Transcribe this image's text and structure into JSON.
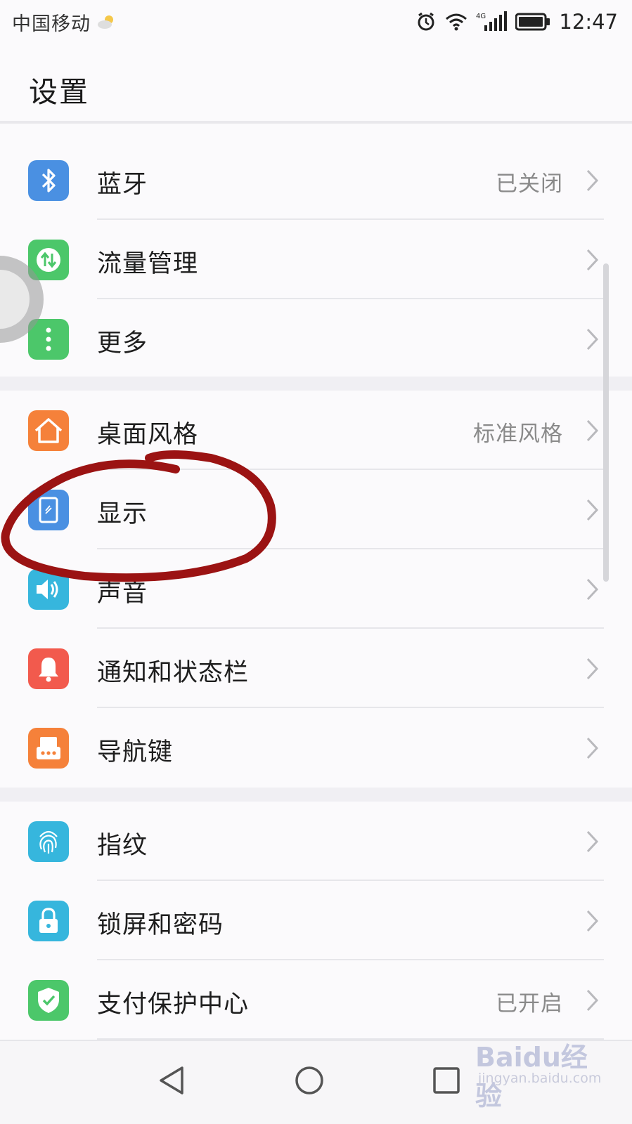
{
  "status_bar": {
    "carrier": "中国移动",
    "time": "12:47",
    "network": "4G"
  },
  "header": {
    "title": "设置"
  },
  "groups": [
    {
      "rows": [
        {
          "label": "蓝牙",
          "value": "已关闭",
          "icon": "bluetooth-icon",
          "color": "#4a90e2"
        },
        {
          "label": "流量管理",
          "value": "",
          "icon": "data-usage-icon",
          "color": "#4cc76a"
        },
        {
          "label": "更多",
          "value": "",
          "icon": "more-dots-icon",
          "color": "#4cc76a"
        }
      ]
    },
    {
      "rows": [
        {
          "label": "桌面风格",
          "value": "标准风格",
          "icon": "home-icon",
          "color": "#f5813a"
        },
        {
          "label": "显示",
          "value": "",
          "icon": "display-icon",
          "color": "#4a90e2"
        },
        {
          "label": "声音",
          "value": "",
          "icon": "speaker-icon",
          "color": "#36b6dd"
        },
        {
          "label": "通知和状态栏",
          "value": "",
          "icon": "bell-icon",
          "color": "#f25a4d"
        },
        {
          "label": "导航键",
          "value": "",
          "icon": "navigation-key-icon",
          "color": "#f5813a"
        }
      ]
    },
    {
      "rows": [
        {
          "label": "指纹",
          "value": "",
          "icon": "fingerprint-icon",
          "color": "#36b6dd"
        },
        {
          "label": "锁屏和密码",
          "value": "",
          "icon": "lock-icon",
          "color": "#36b6dd"
        },
        {
          "label": "支付保护中心",
          "value": "已开启",
          "icon": "shield-check-icon",
          "color": "#4cc76a"
        }
      ]
    }
  ],
  "annotation": {
    "color": "#9b1313"
  },
  "watermark": {
    "text": "Baidu经验",
    "sub": "jingyan.baidu.com"
  }
}
